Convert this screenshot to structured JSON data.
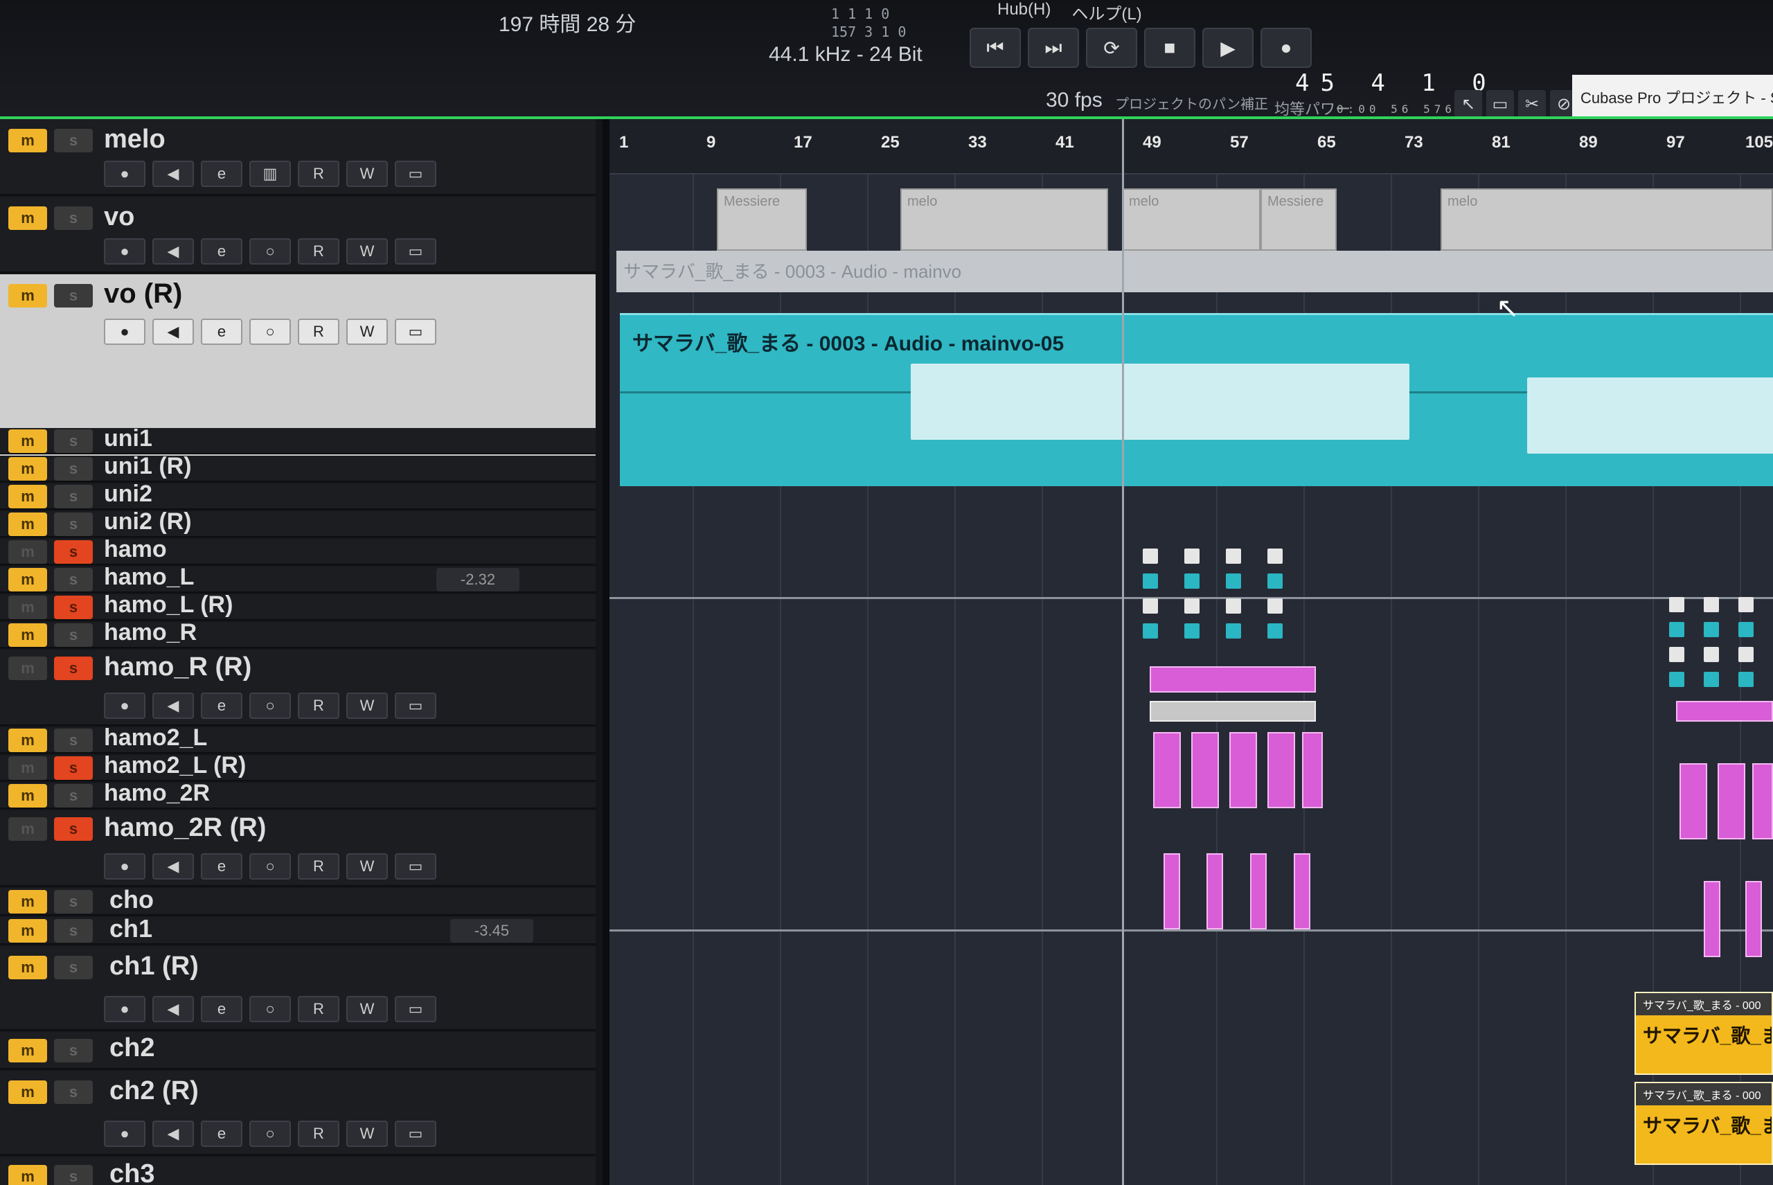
{
  "toolbar": {
    "duration": "197 時間 28 分",
    "sample_rate": "44.1 kHz - 24 Bit",
    "frame_rate": "30 fps",
    "project_pan": "プロジェクトのパン補正",
    "equal_power": "均等パワー",
    "position_a": "157 3 1 0",
    "position_b": "1 1 1 0",
    "counter": "45 4 1 0",
    "counter_sub": "0:00 56 576",
    "project_tab": "Cubase Pro プロジェクト - Sum",
    "menu_hub": "Hub(H)",
    "menu_help": "ヘルプ(L)"
  },
  "transport": [
    "⏮",
    "⏭",
    "⟳",
    "■",
    "▶",
    "●"
  ],
  "tools_icons": [
    "pointer-icon",
    "select-icon",
    "cut-icon",
    "glue-icon",
    "erase-icon",
    "zoom-icon",
    "mute-x-icon",
    "hand-icon",
    "split-icon",
    "pencil-icon",
    "line-icon"
  ],
  "tracks": [
    {
      "name": "melo"
    },
    {
      "name": "vo"
    },
    {
      "name": "vo (R)"
    },
    {
      "name": "uni1"
    },
    {
      "name": "uni1 (R)"
    },
    {
      "name": "uni2"
    },
    {
      "name": "uni2 (R)"
    },
    {
      "name": "hamo"
    },
    {
      "name": "hamo_L",
      "volume": "-2.32"
    },
    {
      "name": "hamo_L (R)"
    },
    {
      "name": "hamo_R"
    },
    {
      "name": "hamo_R (R)"
    },
    {
      "name": "hamo2_L"
    },
    {
      "name": "hamo2_L (R)"
    },
    {
      "name": "hamo_2R"
    },
    {
      "name": "hamo_2R (R)"
    },
    {
      "name": "cho"
    },
    {
      "name": "ch1",
      "volume": "-3.45"
    },
    {
      "name": "ch1 (R)"
    },
    {
      "name": "ch2"
    },
    {
      "name": "ch2 (R)"
    },
    {
      "name": "ch3"
    }
  ],
  "buttons": {
    "m": "m",
    "s": "s",
    "r": "R",
    "w": "W"
  },
  "ruler": [
    "1",
    "9",
    "17",
    "25",
    "33",
    "41",
    "49",
    "57",
    "65",
    "73",
    "81",
    "89",
    "97",
    "105"
  ],
  "parts": {
    "melo_1": "Messiere",
    "melo_2": "melo",
    "melo_3": "melo",
    "melo_4": "Messiere",
    "melo_5": "melo",
    "audio_ghost": "サマラバ_歌_まる - 0003 - Audio - mainvo",
    "audio_main": "サマラバ_歌_まる - 0003 - Audio - mainvo-05",
    "yellow_head_1": "サマラバ_歌_まる - 000",
    "yellow_1": "サマラバ_歌_まる -",
    "yellow_head_2": "サマラバ_歌_まる - 000",
    "yellow_2": "サマラバ_歌_まる"
  },
  "colors": {
    "mute": "#f0b52b",
    "solo": "#e2451f",
    "audio": "#30b8c4",
    "midi": "#d85dd6",
    "yellow_part": "#f2b81c",
    "marker_line": "#2fd35a"
  }
}
